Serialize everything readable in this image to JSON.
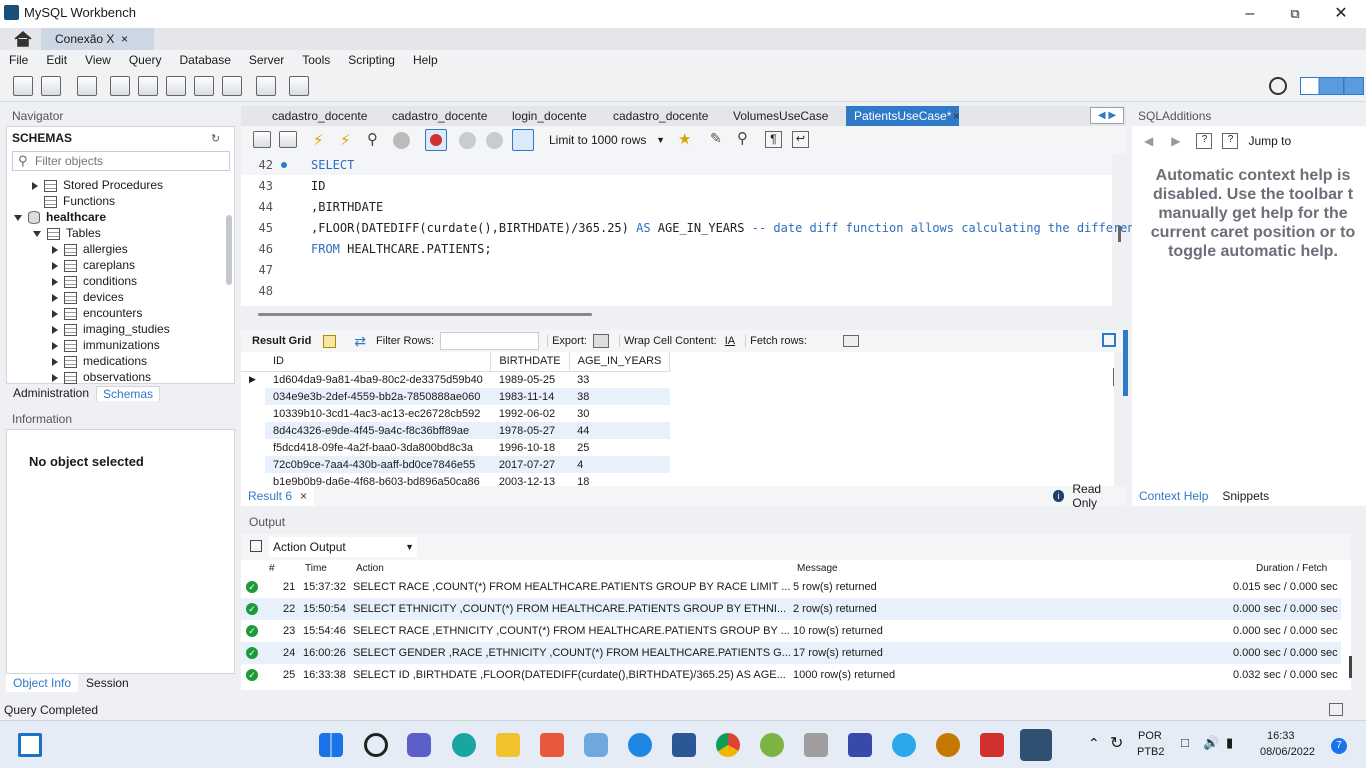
{
  "window": {
    "title": "MySQL Workbench"
  },
  "connection_tab": {
    "label": "Conexão X",
    "close": "×"
  },
  "menu": [
    "File",
    "Edit",
    "View",
    "Query",
    "Database",
    "Server",
    "Tools",
    "Scripting",
    "Help"
  ],
  "navigator": {
    "title": "Navigator",
    "schemas_label": "SCHEMAS",
    "filter_placeholder": "Filter objects",
    "tree": [
      {
        "label": "Stored Procedures",
        "kind": "folder"
      },
      {
        "label": "Functions",
        "kind": "folder"
      },
      {
        "label": "healthcare",
        "kind": "schema"
      },
      {
        "label": "Tables",
        "kind": "folder"
      },
      {
        "label": "allergies",
        "kind": "table"
      },
      {
        "label": "careplans",
        "kind": "table"
      },
      {
        "label": "conditions",
        "kind": "table"
      },
      {
        "label": "devices",
        "kind": "table"
      },
      {
        "label": "encounters",
        "kind": "table"
      },
      {
        "label": "imaging_studies",
        "kind": "table"
      },
      {
        "label": "immunizations",
        "kind": "table"
      },
      {
        "label": "medications",
        "kind": "table"
      },
      {
        "label": "observations",
        "kind": "table"
      }
    ],
    "tabs": [
      "Administration",
      "Schemas"
    ]
  },
  "information": {
    "title": "Information",
    "message": "No object selected"
  },
  "object_tabs": [
    "Object Info",
    "Session"
  ],
  "query_tabs": [
    "cadastro_docente",
    "cadastro_docente",
    "login_docente",
    "cadastro_docente",
    "VolumesUseCase",
    "PatientsUseCase*"
  ],
  "query_tab_close": "×",
  "editor_toolbar": {
    "limit_label": "Limit to 1000 rows"
  },
  "editor": {
    "lines": [
      {
        "n": "42",
        "code": "SELECT"
      },
      {
        "n": "43",
        "code": "ID"
      },
      {
        "n": "44",
        "code": ",BIRTHDATE"
      },
      {
        "n": "45",
        "pre": ",FLOOR(DATEDIFF(curdate(),BIRTHDATE)/365.25) ",
        "kw": "AS",
        "post": " AGE_IN_YEARS ",
        "comment": "-- date diff function allows calculating the differen"
      },
      {
        "n": "46",
        "code": "FROM HEALTHCARE.PATIENTS;"
      },
      {
        "n": "47",
        "code": ""
      },
      {
        "n": "48",
        "code": ""
      }
    ]
  },
  "result_toolbar": {
    "result_grid": "Result Grid",
    "filter_rows": "Filter Rows:",
    "export": "Export:",
    "wrap": "Wrap Cell Content:",
    "fetch": "Fetch rows:"
  },
  "result_grid": {
    "columns": [
      "ID",
      "BIRTHDATE",
      "AGE_IN_YEARS"
    ],
    "rows": [
      [
        "1d604da9-9a81-4ba9-80c2-de3375d59b40",
        "1989-05-25",
        "33"
      ],
      [
        "034e9e3b-2def-4559-bb2a-7850888ae060",
        "1983-11-14",
        "38"
      ],
      [
        "10339b10-3cd1-4ac3-ac13-ec26728cb592",
        "1992-06-02",
        "30"
      ],
      [
        "8d4c4326-e9de-4f45-9a4c-f8c36bff89ae",
        "1978-05-27",
        "44"
      ],
      [
        "f5dcd418-09fe-4a2f-baa0-3da800bd8c3a",
        "1996-10-18",
        "25"
      ],
      [
        "72c0b9ce-7aa4-430b-aaff-bd0ce7846e55",
        "2017-07-27",
        "4"
      ],
      [
        "b1e9b0b9-da6e-4f68-b603-bd896a50ca86",
        "2003-12-13",
        "18"
      ]
    ]
  },
  "result_tab": {
    "label": "Result 6",
    "close": "×",
    "readonly": "Read Only"
  },
  "output": {
    "title": "Output",
    "selector": "Action Output",
    "columns": [
      "#",
      "Time",
      "Action",
      "Message",
      "Duration / Fetch"
    ],
    "rows": [
      {
        "n": "21",
        "time": "15:37:32",
        "action": "SELECT  RACE ,COUNT(*) FROM HEALTHCARE.PATIENTS GROUP BY RACE LIMIT ...",
        "message": "5 row(s) returned",
        "duration": "0.015 sec / 0.000 sec"
      },
      {
        "n": "22",
        "time": "15:50:54",
        "action": "SELECT  ETHNICITY ,COUNT(*) FROM HEALTHCARE.PATIENTS GROUP BY ETHNI...",
        "message": "2 row(s) returned",
        "duration": "0.000 sec / 0.000 sec"
      },
      {
        "n": "23",
        "time": "15:54:46",
        "action": "SELECT  RACE ,ETHNICITY ,COUNT(*) FROM HEALTHCARE.PATIENTS GROUP BY ...",
        "message": "10 row(s) returned",
        "duration": "0.000 sec / 0.000 sec"
      },
      {
        "n": "24",
        "time": "16:00:26",
        "action": "SELECT  GENDER ,RACE ,ETHNICITY ,COUNT(*) FROM HEALTHCARE.PATIENTS G...",
        "message": "17 row(s) returned",
        "duration": "0.000 sec / 0.000 sec"
      },
      {
        "n": "25",
        "time": "16:33:38",
        "action": "SELECT  ID ,BIRTHDATE ,FLOOR(DATEDIFF(curdate(),BIRTHDATE)/365.25) AS AGE...",
        "message": "1000 row(s) returned",
        "duration": "0.032 sec / 0.000 sec"
      }
    ]
  },
  "sql_additions": {
    "title": "SQLAdditions",
    "jump_to": "Jump to",
    "help_text": "Automatic context help is disabled. Use the toolbar t manually get help for the current caret position or to toggle automatic help.",
    "tabs": [
      "Context Help",
      "Snippets"
    ]
  },
  "status": {
    "text": "Query Completed"
  },
  "tray": {
    "lang": "POR",
    "layout": "PTB2",
    "time": "16:33",
    "date": "08/06/2022",
    "badge": "7"
  },
  "colors": {
    "accent": "#2f79c9",
    "ok": "#1b9a3a",
    "keyword": "#2c6fbe"
  }
}
